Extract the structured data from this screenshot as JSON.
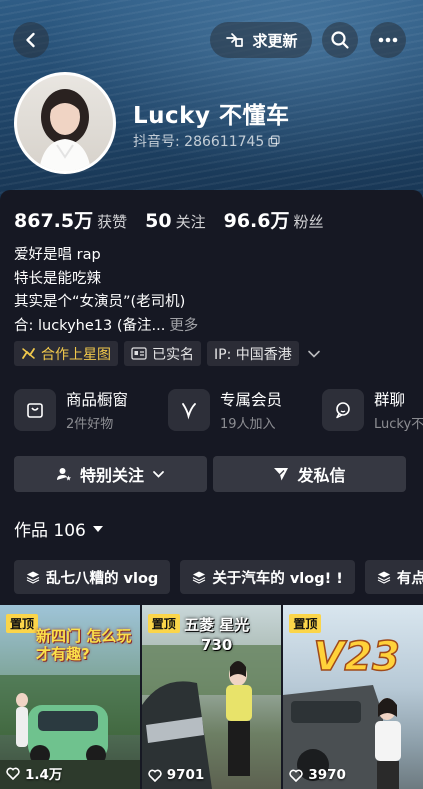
{
  "header": {
    "update_label": "求更新",
    "icons": [
      "back-icon",
      "hand-point-icon",
      "search-icon",
      "more-icon"
    ]
  },
  "profile": {
    "name": "Lucky 不懂车",
    "id_label": "抖音号: 286611745",
    "stats": [
      {
        "value": "867.5万",
        "label": "获赞"
      },
      {
        "value": "50",
        "label": "关注"
      },
      {
        "value": "96.6万",
        "label": "粉丝"
      }
    ],
    "bio": [
      "爱好是唱 rap",
      "特长是能吃辣",
      "其实是个“女演员”(老司机)",
      "合: luckyhe13 (备注..."
    ],
    "bio_more": "更多",
    "tags": [
      {
        "label": "合作上星图",
        "icon": "star-chart-icon",
        "color": "#f2c94c"
      },
      {
        "label": "已实名",
        "icon": "id-card-icon"
      },
      {
        "label": "IP: 中国香港",
        "icon": ""
      }
    ]
  },
  "services": [
    {
      "title": "商品橱窗",
      "subtitle": "2件好物",
      "icon": "shopping-bag-icon"
    },
    {
      "title": "专属会员",
      "subtitle": "19人加入",
      "icon": "vip-v-icon"
    },
    {
      "title": "群聊",
      "subtitle": "Lucky不",
      "icon": "chat-bubble-icon"
    }
  ],
  "actions": {
    "follow_label": "特别关注",
    "message_label": "发私信"
  },
  "works": {
    "label": "作品 106"
  },
  "collections": [
    {
      "label": "乱七八糟的 vlog"
    },
    {
      "label": "关于汽车的 vlog! !"
    },
    {
      "label": "有点"
    }
  ],
  "videos": [
    {
      "pin": "置顶",
      "caption": "新四门 怎么玩才有趣?",
      "likes": "1.4万"
    },
    {
      "pin": "置顶",
      "caption": "五菱 星光730",
      "likes": "9701"
    },
    {
      "pin": "置顶",
      "caption": "V23",
      "likes": "3970"
    }
  ],
  "colors": {
    "background": "#161823",
    "accent_gold": "#f2c94c",
    "pin_yellow": "#fbd54a"
  }
}
